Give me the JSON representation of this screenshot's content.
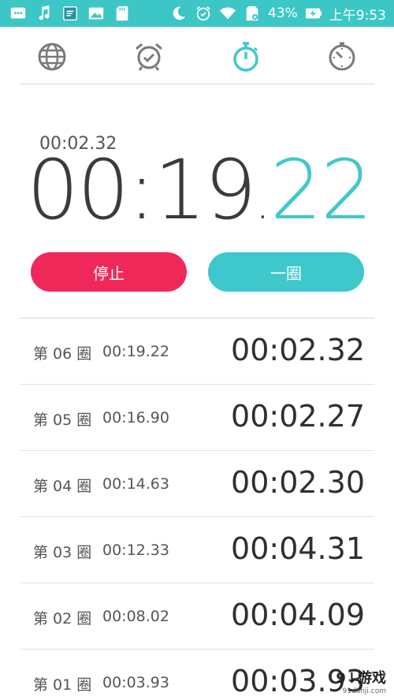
{
  "status_bar": {
    "icons_left": [
      "message-icon",
      "music-note-icon",
      "screen-cast-icon",
      "image-icon",
      "sd-card-icon"
    ],
    "icons_right": [
      "moon-icon",
      "alarm-icon",
      "wifi-icon",
      "sim-missing-icon",
      "battery-charging-icon"
    ],
    "battery": "43%",
    "time": "上午9:53",
    "background_color": "#3cc6c6"
  },
  "tabs": [
    {
      "name": "world-clock",
      "icon": "globe-icon",
      "active": false
    },
    {
      "name": "alarm",
      "icon": "alarm-clock-icon",
      "active": false
    },
    {
      "name": "stopwatch",
      "icon": "stopwatch-icon",
      "active": true
    },
    {
      "name": "timer",
      "icon": "timer-icon",
      "active": false
    }
  ],
  "stopwatch": {
    "current_lap": "00:02.32",
    "main_minutes_seconds": "00:19",
    "main_separator": ".",
    "main_centiseconds": "22",
    "accent_color": "#41c8cc"
  },
  "buttons": {
    "stop_label": "停止",
    "lap_label": "一圈",
    "stop_color": "#f0285a",
    "lap_color": "#3ec8cb"
  },
  "laps": [
    {
      "label": "第 06 圈",
      "total": "00:19.22",
      "split": "00:02.32"
    },
    {
      "label": "第 05 圈",
      "total": "00:16.90",
      "split": "00:02.27"
    },
    {
      "label": "第 04 圈",
      "total": "00:14.63",
      "split": "00:02.30"
    },
    {
      "label": "第 03 圈",
      "total": "00:12.33",
      "split": "00:04.31"
    },
    {
      "label": "第 02 圈",
      "total": "00:08.02",
      "split": "00:04.09"
    },
    {
      "label": "第 01 圈",
      "total": "00:03.93",
      "split": "00:03.93"
    }
  ],
  "watermark": {
    "brand": "9↓游戏",
    "site": "91danji.com"
  }
}
